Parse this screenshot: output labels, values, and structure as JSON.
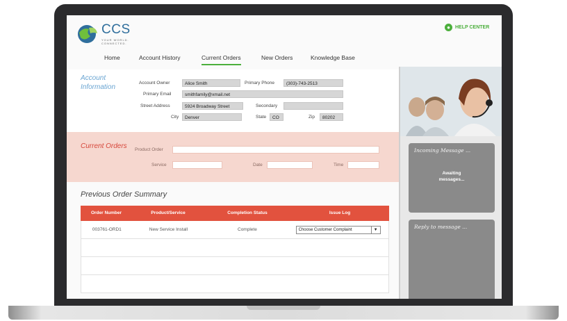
{
  "brand": {
    "name": "CCS",
    "tagline": "YOUR WORLD. CONNECTED."
  },
  "header": {
    "help_label": "HELP CENTER"
  },
  "nav": [
    "Home",
    "Account History",
    "Current Orders",
    "New Orders",
    "Knowledge Base"
  ],
  "account": {
    "title": "Account Information",
    "owner_label": "Account Owner",
    "owner": "Alice Smith",
    "phone_label": "Primary Phone",
    "phone": "(303)-743-2513",
    "email_label": "Primary Email",
    "email": "smithfamily@xmail.net",
    "street_label": "Street Address",
    "street": "5924 Broadway  Street",
    "secondary_label": "Secondary",
    "secondary": "",
    "city_label": "City",
    "city": "Denver",
    "state_label": "State",
    "state": "CO",
    "zip_label": "Zip",
    "zip": "80202"
  },
  "current_orders": {
    "title": "Current Orders",
    "product_order_label": "Product Order",
    "service_label": "Service",
    "date_label": "Date",
    "time_label": "Time"
  },
  "previous": {
    "title": "Previous Order Summary",
    "columns": [
      "Order Number",
      "Product/Service",
      "Completion Status",
      "Issue Log"
    ],
    "rows": [
      {
        "order": "003761-ORD1",
        "product": "New Service Install",
        "status": "Complete",
        "issue": "Choose Customer Complaint"
      }
    ]
  },
  "side": {
    "incoming_title": "Incoming Message ...",
    "incoming_body_1": "Awaiting",
    "incoming_body_2": "messages...",
    "reply_title": "Reply to message ..."
  },
  "colors": {
    "accent_green": "#4caf3c",
    "header_red": "#e2523e",
    "section_pink": "#f6d7cf",
    "title_blue": "#6aa5d2"
  }
}
